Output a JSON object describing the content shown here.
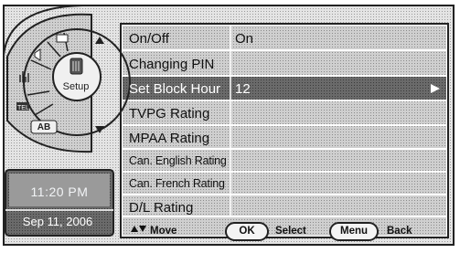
{
  "menu": {
    "items": [
      {
        "label": "On/Off",
        "value": "On"
      },
      {
        "label": "Changing PIN",
        "value": ""
      },
      {
        "label": "Set Block Hour",
        "value": "12",
        "selected": true
      },
      {
        "label": "TVPG Rating",
        "value": ""
      },
      {
        "label": "MPAA Rating",
        "value": ""
      },
      {
        "label": "Can. English Rating",
        "value": ""
      },
      {
        "label": "Can. French Rating",
        "value": ""
      },
      {
        "label": "D/L Rating",
        "value": ""
      }
    ]
  },
  "clock": {
    "time": "11:20 PM",
    "date": "Sep 11, 2006"
  },
  "wheel": {
    "center_label": "Setup",
    "ab_label": "AB",
    "icons": [
      "tv-icon",
      "sound-icon",
      "picture-icon",
      "setup-icon",
      "ab-icon",
      "caption-icon"
    ]
  },
  "footer": {
    "move_label": "Move",
    "ok_label": "OK",
    "select_label": "Select",
    "menu_label": "Menu",
    "back_label": "Back"
  },
  "colors": {
    "selected_row": "#707070",
    "row": "#d4d4d4",
    "clock_bg": "#8a8a8a"
  }
}
